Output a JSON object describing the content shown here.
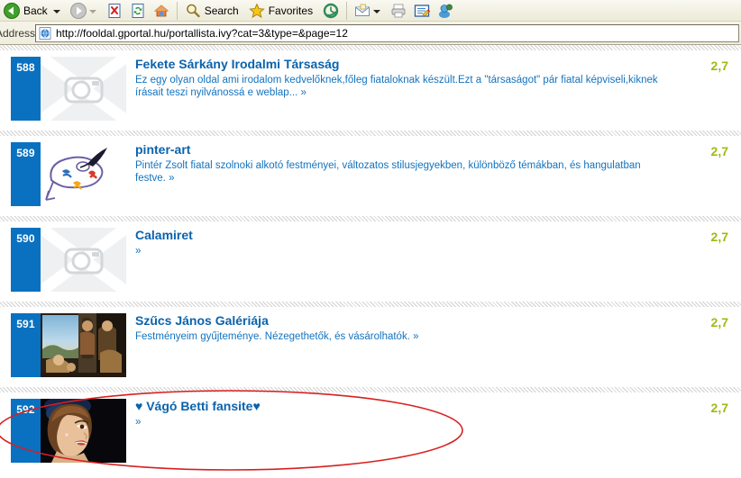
{
  "browser": {
    "back_label": "Back",
    "search_label": "Search",
    "favorites_label": "Favorites",
    "address_label": "Address",
    "url": "http://fooldal.gportal.hu/portallista.ivy?cat=3&type=&page=12",
    "icons": {
      "back": "back-arrow-icon",
      "forward": "forward-arrow-icon",
      "stop": "stop-icon",
      "refresh": "refresh-icon",
      "home": "home-icon",
      "search": "search-icon",
      "favorites": "favorites-star-icon",
      "history": "history-icon",
      "mail": "mail-icon",
      "print": "print-icon",
      "edit": "edit-icon",
      "messenger": "messenger-icon",
      "page": "page-icon"
    }
  },
  "colors": {
    "badge_blue": "#0a71c0",
    "title_blue": "#0a63ad",
    "desc_blue": "#1273bf",
    "rating_green": "#9dbb12",
    "annotation_red": "#d81f1f"
  },
  "listing": {
    "rows": [
      {
        "number": "588",
        "title": "Fekete Sárkány Irodalmi Társaság",
        "description": "Ez egy olyan oldal ami irodalom kedvelőknek,főleg fiataloknak készült.Ezt a \"társaságot\" pár fiatal képviseli,kiknek írásait teszi nyilvánossá e weblap... »",
        "rating": "2,7",
        "thumb": "no-image-placeholder"
      },
      {
        "number": "589",
        "title": "pinter-art",
        "description": "Pintér Zsolt fiatal szolnoki alkotó festményei, változatos stilusjegyekben, különböző témákban, és hangulatban festve. »",
        "rating": "2,7",
        "thumb": "palette-logo"
      },
      {
        "number": "590",
        "title": "Calamiret",
        "description": "»",
        "rating": "2,7",
        "thumb": "no-image-placeholder"
      },
      {
        "number": "591",
        "title": "Szűcs János Galériája",
        "description": "Festményeim gyűjteménye. Nézegethetők, és vásárolhatók. »",
        "rating": "2,7",
        "thumb": "painting-photo"
      },
      {
        "number": "592",
        "title": "♥ Vágó Betti fansite♥",
        "description": "»",
        "rating": "2,7",
        "thumb": "portrait-photo"
      }
    ]
  },
  "annotation": {
    "shape": "red-ellipse-highlight"
  }
}
